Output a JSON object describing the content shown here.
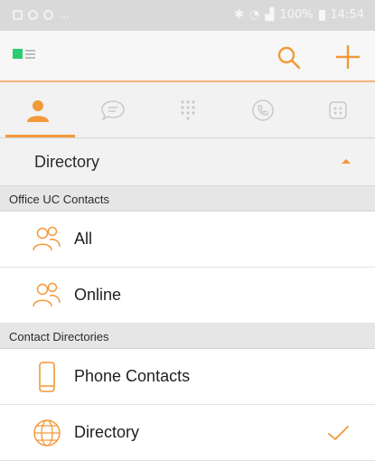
{
  "status_bar": {
    "battery": "100%",
    "time": "14:54"
  },
  "header": {
    "menu_icon": "menu-icon",
    "search_icon": "search-icon",
    "add_icon": "plus-icon"
  },
  "tabs": [
    {
      "icon": "contacts-person-icon",
      "active": true
    },
    {
      "icon": "chat-bubble-icon",
      "active": false
    },
    {
      "icon": "dialpad-icon",
      "active": false
    },
    {
      "icon": "call-history-icon",
      "active": false
    },
    {
      "icon": "voicemail-icon",
      "active": false
    }
  ],
  "section": {
    "title": "Directory",
    "expanded": true
  },
  "groups": [
    {
      "title": "Office UC Contacts",
      "items": [
        {
          "label": "All",
          "icon": "people-group-icon",
          "selected": false
        },
        {
          "label": "Online",
          "icon": "people-group-icon",
          "selected": false
        }
      ]
    },
    {
      "title": "Contact Directories",
      "items": [
        {
          "label": "Phone Contacts",
          "icon": "smartphone-icon",
          "selected": false
        },
        {
          "label": "Directory",
          "icon": "globe-icon",
          "selected": true
        }
      ]
    }
  ],
  "colors": {
    "accent": "#f29939",
    "menu_square": "#2ecc71",
    "status_bar": "#d9d9d9",
    "group_header_bg": "#e6e6e6"
  }
}
